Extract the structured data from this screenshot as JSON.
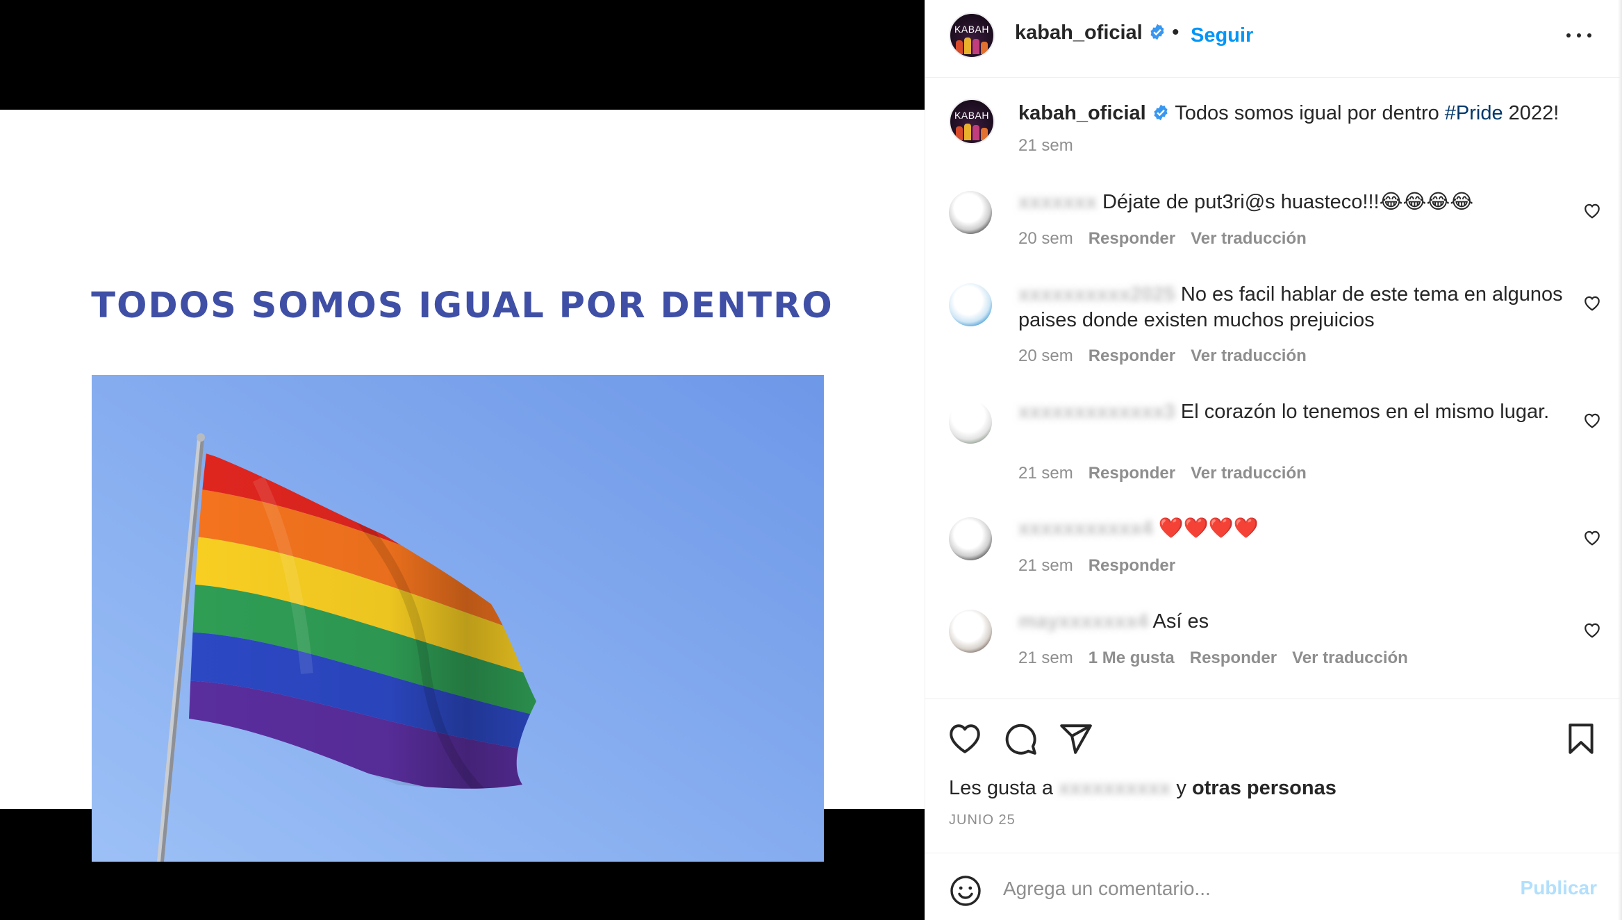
{
  "post": {
    "slide_title": "TODOS SOMOS IGUAL POR DENTRO",
    "photo_subject": "rainbow-pride-flag"
  },
  "header": {
    "username": "kabah_oficial",
    "avatar_text": "KABAH",
    "separator": "•",
    "follow_label": "Seguir",
    "more_icon": "more-horizontal-icon"
  },
  "caption": {
    "username": "kabah_oficial",
    "text_before": "Todos somos igual por dentro ",
    "hashtag": "#Pride",
    "text_after": " 2022!",
    "time": "21 sem"
  },
  "comments": [
    {
      "user": "xxxxxxx",
      "text": "Déjate de put3ri@s huasteco!!!😂😂😂😂",
      "time": "20 sem",
      "likes": "",
      "reply": "Responder",
      "translate": "Ver traducción"
    },
    {
      "user": "xxxxxxxxxx2025",
      "text": "No es facil hablar de este tema en algunos paises donde existen muchos prejuicios",
      "time": "20 sem",
      "likes": "",
      "reply": "Responder",
      "translate": "Ver traducción"
    },
    {
      "user": "xxxxxxxxxxxxx3",
      "text": "El corazón lo tenemos en el mismo lugar.",
      "time": "21 sem",
      "likes": "",
      "reply": "Responder",
      "translate": "Ver traducción"
    },
    {
      "user": "xxxxxxxxxxx4",
      "text": "❤️❤️❤️❤️",
      "time": "21 sem",
      "likes": "",
      "reply": "Responder",
      "translate": ""
    },
    {
      "user": "mayxxxxxxx4",
      "text": "Así es",
      "time": "21 sem",
      "likes": "1 Me gusta",
      "reply": "Responder",
      "translate": "Ver traducción"
    }
  ],
  "actions": {
    "like_icon": "heart-icon",
    "comment_icon": "comment-icon",
    "share_icon": "send-icon",
    "save_icon": "bookmark-icon"
  },
  "likes": {
    "prefix": "Les gusta a",
    "hidden_user": "xxxxxxxxxx",
    "joiner": "y",
    "others": "otras personas"
  },
  "date": "JUNIO 25",
  "composer": {
    "placeholder": "Agrega un comentario...",
    "publish_label": "Publicar",
    "emoji_icon": "emoji-icon"
  },
  "colors": {
    "accent": "#0095f6",
    "hashtag": "#00376b",
    "secondary_text": "#8e8e8e",
    "slide_title": "#3f4fa6",
    "sky": "#7fa7ee"
  }
}
